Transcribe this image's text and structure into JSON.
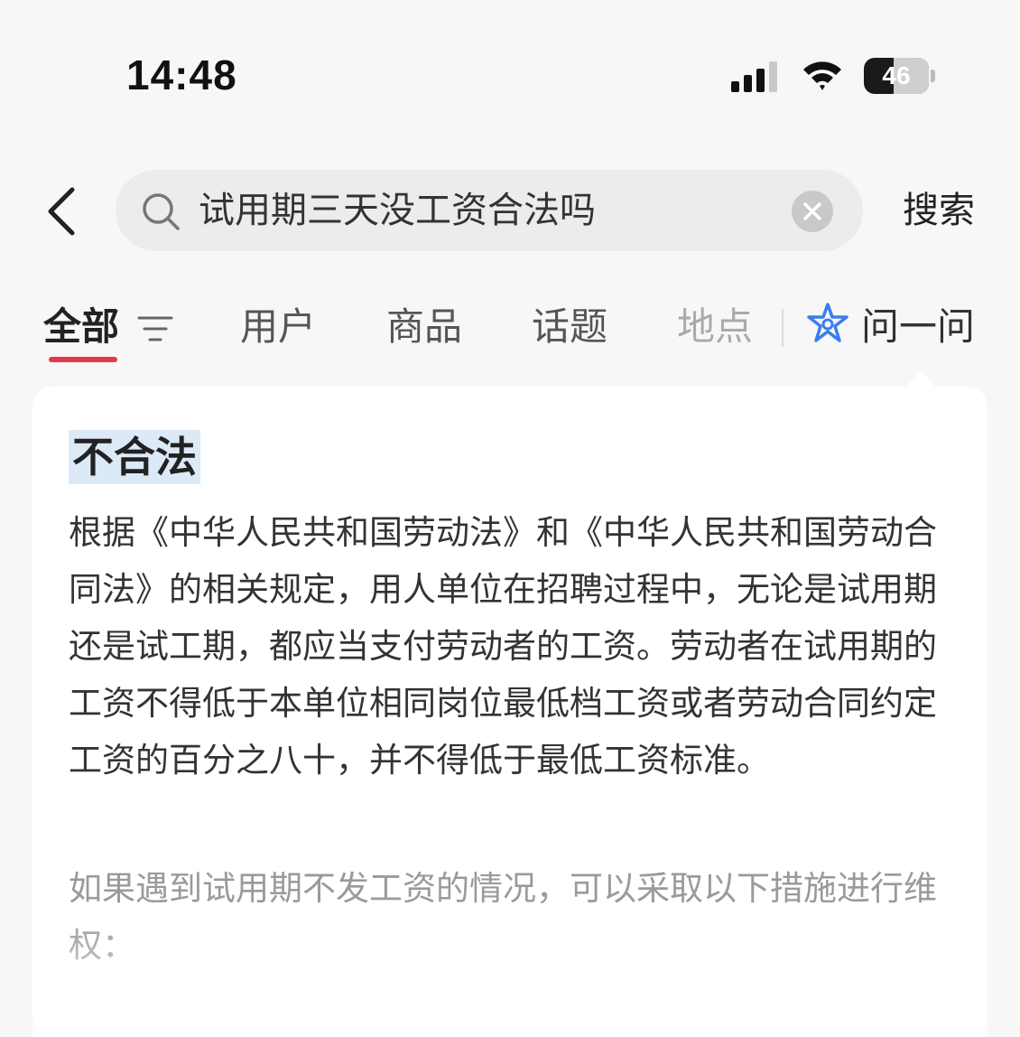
{
  "status_bar": {
    "time": "14:48",
    "battery_level": "46",
    "battery_fraction": 0.46,
    "signal_icon": "signal-bars-icon",
    "wifi_icon": "wifi-icon"
  },
  "search": {
    "query": "试用期三天没工资合法吗",
    "button_label": "搜索",
    "back_icon": "chevron-left-icon",
    "search_icon": "magnifier-icon",
    "clear_icon": "clear-x-icon"
  },
  "tabs": {
    "items": [
      {
        "label": "全部",
        "active": true
      },
      {
        "label": "用户"
      },
      {
        "label": "商品"
      },
      {
        "label": "话题"
      },
      {
        "label": "地点"
      },
      {
        "label": "问一问"
      }
    ],
    "accent_color": "#e23a4b",
    "ai_icon_color": "#3b7df0"
  },
  "answer": {
    "heading": "不合法",
    "paragraph_1": "根据《中华人民共和国劳动法》和《中华人民共和国劳动合同法》的相关规定，用人单位在招聘过程中，无论是试用期还是试工期，都应当支付劳动者的工资。劳动者在试用期的工资不得低于本单位相同岗位最低档工资或者劳动合同约定工资的百分之八十，并不得低于最低工资标准。",
    "paragraph_2": "如果遇到试用期不发工资的情况，可以采取以下措施进行维权："
  }
}
